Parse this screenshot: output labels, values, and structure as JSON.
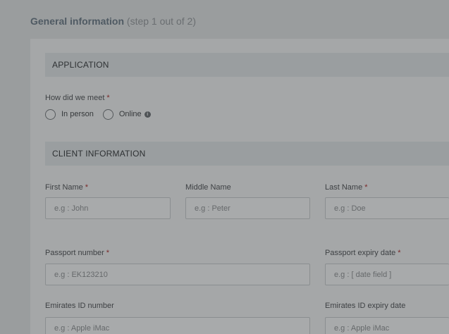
{
  "header": {
    "title": "General information",
    "step": "(step 1 out of 2)"
  },
  "sections": {
    "application": "APPLICATION",
    "client": "CLIENT INFORMATION"
  },
  "application": {
    "meet_label": "How did we meet",
    "required_mark": "*",
    "options": [
      "In person",
      "Online"
    ],
    "info_icon_glyph": "i"
  },
  "client": {
    "first_name": {
      "label": "First Name",
      "placeholder": "e.g : John"
    },
    "middle_name": {
      "label": "Middle Name",
      "placeholder": "e.g : Peter"
    },
    "last_name": {
      "label": "Last Name",
      "placeholder": "e.g : Doe"
    },
    "passport_number": {
      "label": "Passport number",
      "placeholder": "e.g : EK123210"
    },
    "passport_expiry": {
      "label": "Passport expiry date",
      "placeholder": "e.g : [ date field ]"
    },
    "emirates_id": {
      "label": "Emirates ID number",
      "placeholder": "e.g : Apple iMac"
    },
    "emirates_expiry": {
      "label": "Emirates ID expiry date",
      "placeholder": "e.g : Apple iMac"
    }
  }
}
